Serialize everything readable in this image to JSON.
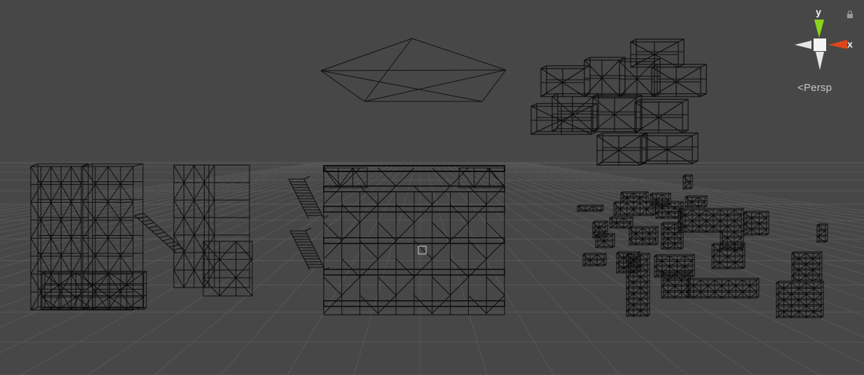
{
  "viewport": {
    "name": "Scene view",
    "render_mode": "wireframe",
    "background_color": "#474747",
    "grid_color": "#5b5b5b",
    "wire_color": "#0c0c0c"
  },
  "gizmo": {
    "axis_y_label": "y",
    "axis_x_label": "x",
    "axis_y_color": "#8ad51c",
    "axis_x_color": "#e0461c",
    "neutral_cone_color": "#e6e6e6",
    "center_cube_color": "#f4f4f4",
    "projection_label": "Persp",
    "projection_icon": "perspective-chevron-icon",
    "lock_icon": "lock-icon"
  },
  "scene_objects": [
    {
      "name": "camera-frustum-wireframe"
    },
    {
      "name": "building-left-wireframe"
    },
    {
      "name": "building-center-left-wireframe"
    },
    {
      "name": "stairs-wireframe"
    },
    {
      "name": "building-main-wireframe"
    },
    {
      "name": "floating-blocks-wireframe"
    },
    {
      "name": "props-cluster-wireframe"
    }
  ]
}
